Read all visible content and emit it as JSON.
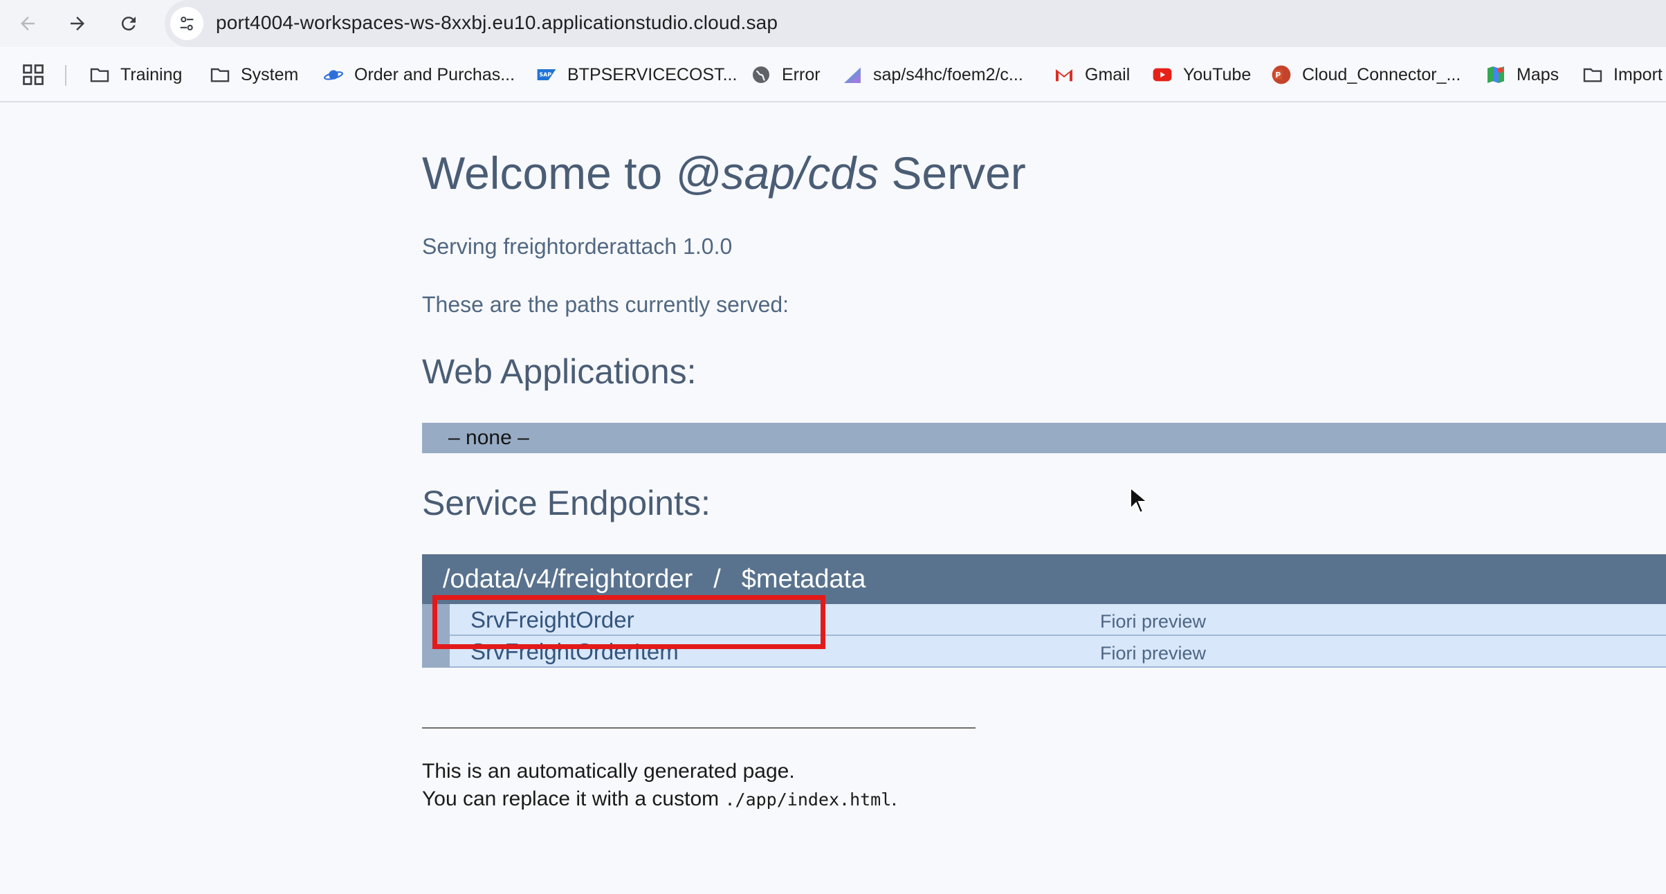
{
  "browser": {
    "url": "port4004-workspaces-ws-8xxbj.eu10.applicationstudio.cloud.sap",
    "nav": {
      "back_icon": "arrow-left-icon",
      "forward_icon": "arrow-right-icon",
      "reload_icon": "reload-icon",
      "site_info_icon": "tune-icon"
    }
  },
  "bookmarks": [
    {
      "label": "Training",
      "icon": "folder-icon"
    },
    {
      "label": "System",
      "icon": "folder-icon"
    },
    {
      "label": "Order and Purchas...",
      "icon": "planet-icon"
    },
    {
      "label": "BTPSERVICECOST...",
      "icon": "sap-icon"
    },
    {
      "label": "Error",
      "icon": "globe-icon"
    },
    {
      "label": "sap/s4hc/foem2/c...",
      "icon": "chart-icon"
    },
    {
      "label": "Gmail",
      "icon": "gmail-icon"
    },
    {
      "label": "YouTube",
      "icon": "youtube-icon"
    },
    {
      "label": "Cloud_Connector_...",
      "icon": "powerpoint-icon"
    },
    {
      "label": "Maps",
      "icon": "maps-icon"
    },
    {
      "label": "Import",
      "icon": "folder-icon"
    }
  ],
  "page": {
    "title_prefix": "Welcome to ",
    "title_em": "@sap/cds",
    "title_suffix": " Server",
    "serving": "Serving freightorderattach 1.0.0",
    "paths_intro": "These are the paths currently served:",
    "web_apps_heading": "Web Applications:",
    "web_apps_none": "– none –",
    "service_heading": "Service Endpoints:",
    "service": {
      "path": "/odata/v4/freightorder",
      "separator": "/",
      "metadata": "$metadata",
      "entities": [
        {
          "name": "SrvFreightOrder",
          "preview": "Fiori preview"
        },
        {
          "name": "SrvFreightOrderItem",
          "preview": "Fiori preview"
        }
      ]
    },
    "footer_line1": "This is an automatically generated page.",
    "footer_line2_prefix": "You can replace it with a custom ",
    "footer_line2_code": "./app/index.html",
    "footer_line2_suffix": "."
  },
  "colors": {
    "highlight": "#e31a1a",
    "service_header": "#59728e",
    "entity_row": "#d8e7f9",
    "none_bar": "#97abc4"
  }
}
